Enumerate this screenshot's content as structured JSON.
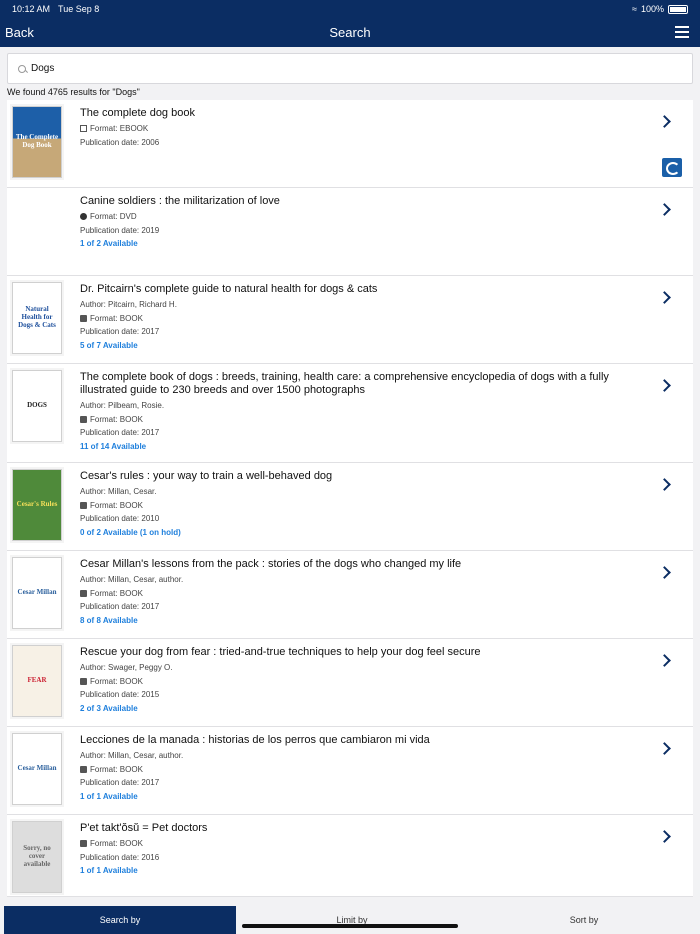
{
  "status": {
    "time": "10:12 AM",
    "date": "Tue Sep 8",
    "battery": "100%"
  },
  "nav": {
    "back": "Back",
    "title": "Search"
  },
  "search": {
    "query": "Dogs"
  },
  "results_text": "We found 4765 results for \"Dogs\"",
  "items": [
    {
      "title": "The complete dog book",
      "author": "",
      "format": "Format: EBOOK",
      "date": "Publication date: 2006",
      "avail": "",
      "cover": "The Complete Dog Book"
    },
    {
      "title": "Canine soldiers : the militarization of love",
      "author": "",
      "format": "Format: DVD",
      "date": "Publication date: 2019",
      "avail": "1 of 2 Available",
      "cover": ""
    },
    {
      "title": "Dr. Pitcairn's complete guide to natural health for dogs & cats",
      "author": "Author: Pitcairn, Richard H.",
      "format": "Format: BOOK",
      "date": "Publication date: 2017",
      "avail": "5 of 7 Available",
      "cover": "Natural Health for Dogs & Cats"
    },
    {
      "title": "The complete book of dogs : breeds, training, health care: a comprehensive encyclopedia of dogs with a fully illustrated guide to 230 breeds and over 1500 photographs",
      "author": "Author: Pilbeam, Rosie.",
      "format": "Format: BOOK",
      "date": "Publication date: 2017",
      "avail": "11 of 14 Available",
      "cover": "DOGS"
    },
    {
      "title": "Cesar's rules : your way to train a well-behaved dog",
      "author": "Author: Millan, Cesar.",
      "format": "Format: BOOK",
      "date": "Publication date: 2010",
      "avail": "0 of 2 Available (1 on hold)",
      "cover": "Cesar's Rules"
    },
    {
      "title": "Cesar Millan's lessons from the pack : stories of the dogs who changed my life",
      "author": "Author: Millan, Cesar, author.",
      "format": "Format: BOOK",
      "date": "Publication date: 2017",
      "avail": "8 of 8 Available",
      "cover": "Cesar Millan"
    },
    {
      "title": "Rescue your dog from fear : tried-and-true techniques to help your dog feel secure",
      "author": "Author: Swager, Peggy O.",
      "format": "Format: BOOK",
      "date": "Publication date: 2015",
      "avail": "2 of 3 Available",
      "cover": "FEAR"
    },
    {
      "title": "Lecciones de la manada : historias de los perros que cambiaron mi vida",
      "author": "Author: Millan, Cesar, author.",
      "format": "Format: BOOK",
      "date": "Publication date: 2017",
      "avail": "1 of 1 Available",
      "cover": "Cesar Millan"
    },
    {
      "title": "P'et takt'ŏsŭ = Pet doctors",
      "author": "",
      "format": "Format: BOOK",
      "date": "Publication date: 2016",
      "avail": "1 of 1 Available",
      "cover": "Sorry, no cover available"
    }
  ],
  "bottom": {
    "search_by": "Search by",
    "limit_by": "Limit by",
    "sort_by": "Sort by"
  }
}
